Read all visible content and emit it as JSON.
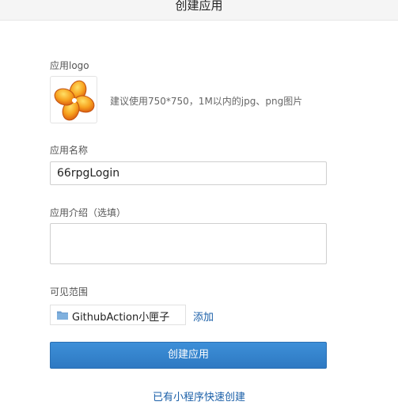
{
  "header": {
    "title": "创建应用"
  },
  "form": {
    "logo": {
      "label": "应用logo",
      "hint": "建议使用750*750，1M以内的jpg、png图片",
      "icon": "app-logo-flower-icon",
      "colors": {
        "petal": "#f28a1e",
        "petal_highlight": "#ffd84a",
        "petal_shadow": "#d85a12"
      }
    },
    "name": {
      "label": "应用名称",
      "value": "66rpgLogin"
    },
    "intro": {
      "label": "应用介绍（选填）",
      "value": ""
    },
    "scope": {
      "label": "可见范围",
      "selected": "GithubAction小匣子",
      "icon": "folder-icon",
      "add_label": "添加"
    },
    "submit_label": "创建应用"
  },
  "footer": {
    "quick_create_label": "已有小程序快速创建"
  },
  "colors": {
    "primary": "#3385d1",
    "link": "#1a5fa8"
  }
}
